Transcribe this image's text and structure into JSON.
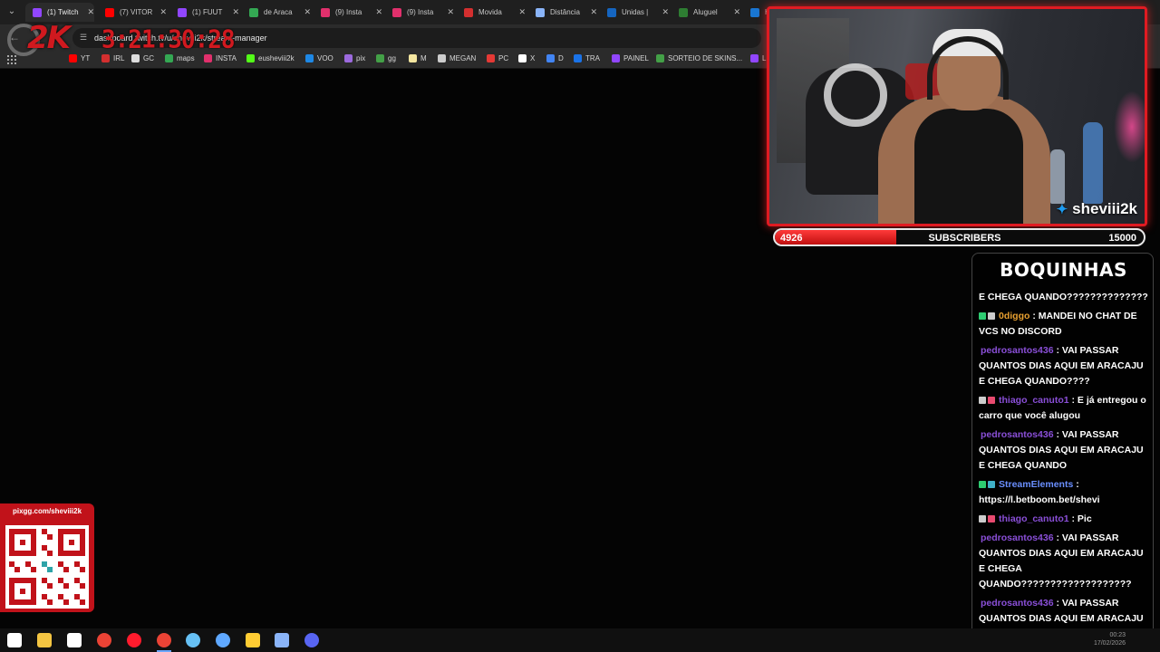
{
  "browser": {
    "tabs": [
      {
        "label": "(1) Twitch",
        "favicon_color": "#9146ff",
        "active": true
      },
      {
        "label": "(7) VITOR",
        "favicon_color": "#ff0000"
      },
      {
        "label": "(1) FUUT",
        "favicon_color": "#9146ff"
      },
      {
        "label": "de Araca",
        "favicon_color": "#34a853"
      },
      {
        "label": "(9) Insta",
        "favicon_color": "#e1306c"
      },
      {
        "label": "(9) Insta",
        "favicon_color": "#e1306c"
      },
      {
        "label": "Movida",
        "favicon_color": "#d32f2f"
      },
      {
        "label": "Distância",
        "favicon_color": "#8ab4f8"
      },
      {
        "label": "Unidas |",
        "favicon_color": "#1565c0"
      },
      {
        "label": "Aluguel",
        "favicon_color": "#2e7d32"
      },
      {
        "label": "H",
        "favicon_color": "#1976d2"
      }
    ],
    "url": "dashboard.twitch.tv/u/sheviii2k/stream-manager",
    "bookmarks": [
      {
        "label": "YT",
        "color": "#ff0000"
      },
      {
        "label": "IRL",
        "color": "#d32f2f"
      },
      {
        "label": "GC",
        "color": "#dddddd"
      },
      {
        "label": "maps",
        "color": "#34a853"
      },
      {
        "label": "INSTA",
        "color": "#e1306c"
      },
      {
        "label": "eusheviii2k",
        "color": "#53fc18"
      },
      {
        "label": "VOO",
        "color": "#1e88e5"
      },
      {
        "label": "pix",
        "color": "#9c6ade"
      },
      {
        "label": "gg",
        "color": "#43a047"
      },
      {
        "label": "M",
        "color": "#f5e6a0"
      },
      {
        "label": "MEGAN",
        "color": "#cccccc"
      },
      {
        "label": "PC",
        "color": "#e53935"
      },
      {
        "label": "X",
        "color": "#ffffff"
      },
      {
        "label": "D",
        "color": "#4285f4"
      },
      {
        "label": "TRA",
        "color": "#1a73e8"
      },
      {
        "label": "PAINEL",
        "color": "#9146ff"
      },
      {
        "label": "SORTEIO DE SKINS...",
        "color": "#43a047"
      },
      {
        "label": "L",
        "color": "#9146ff"
      }
    ]
  },
  "overlay": {
    "logo_text": "2K",
    "timer": "3:21:30:28",
    "accent_color": "#e01b22"
  },
  "webcam": {
    "handle": "sheviii2k",
    "handle_icon": "twitter-bird-icon"
  },
  "goal": {
    "current": "4926",
    "title": "SUBSCRIBERS",
    "target": "15000",
    "progress_fraction": 0.3284
  },
  "chat": {
    "title": "BOQUINHAS",
    "messages": [
      {
        "user": "",
        "user_color": "",
        "badges": [],
        "text": "E CHEGA QUANDO??????????????"
      },
      {
        "user": "0diggo",
        "user_color": "#e8a030",
        "badges": [
          "#2ecc71",
          "#cccccc"
        ],
        "text": ": MANDEI NO CHAT DE VCS NO DISCORD"
      },
      {
        "user": "pedrosantos436",
        "user_color": "#8a4fd8",
        "badges": [],
        "text": ": VAI PASSAR QUANTOS DIAS AQUI EM ARACAJU E CHEGA QUANDO????"
      },
      {
        "user": "thiago_canuto1",
        "user_color": "#8a4fd8",
        "badges": [
          "#cccccc",
          "#e84a6f"
        ],
        "text": ": E já entregou o carro que você alugou"
      },
      {
        "user": "pedrosantos436",
        "user_color": "#8a4fd8",
        "badges": [],
        "text": ": VAI PASSAR QUANTOS DIAS AQUI EM ARACAJU E CHEGA QUANDO"
      },
      {
        "user": "StreamElements",
        "user_color": "#6a8fff",
        "badges": [
          "#2ecc71",
          "#3fb0c8"
        ],
        "text": ": https://l.betboom.bet/shevi"
      },
      {
        "user": "thiago_canuto1",
        "user_color": "#8a4fd8",
        "badges": [
          "#cccccc",
          "#e84a6f"
        ],
        "text": ": Pic"
      },
      {
        "user": "pedrosantos436",
        "user_color": "#8a4fd8",
        "badges": [],
        "text": ": VAI PASSAR QUANTOS DIAS AQUI EM ARACAJU E CHEGA QUANDO???????????????????"
      },
      {
        "user": "pedrosantos436",
        "user_color": "#8a4fd8",
        "badges": [],
        "text": ": VAI PASSAR QUANTOS DIAS AQUI EM ARACAJU E CHEGA QUANDO???"
      }
    ]
  },
  "qr": {
    "label": "pixgg.com/sheviii2k"
  },
  "taskbar": {
    "icons": [
      {
        "name": "windows-start-icon",
        "color": "#ffffff"
      },
      {
        "name": "file-explorer-icon",
        "color": "#f4c542"
      },
      {
        "name": "store-icon",
        "color": "#ffffff"
      },
      {
        "name": "chrome-icon",
        "color": "#ea4335"
      },
      {
        "name": "opera-icon",
        "color": "#ff1b2d"
      },
      {
        "name": "chrome-icon",
        "color": "#ea4335"
      },
      {
        "name": "steam-icon",
        "color": "#66c0f4"
      },
      {
        "name": "app-icon",
        "color": "#5fa8ff"
      },
      {
        "name": "file-icon",
        "color": "#ffcc33"
      },
      {
        "name": "calculator-icon",
        "color": "#8ab4f8"
      },
      {
        "name": "discord-icon",
        "color": "#5865f2"
      }
    ],
    "time": "00:23",
    "date": "17/02/2026"
  }
}
